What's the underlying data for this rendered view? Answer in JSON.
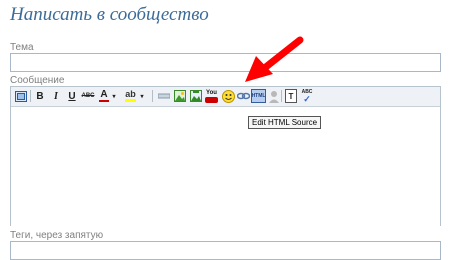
{
  "page": {
    "title": "Написать в сообщество"
  },
  "form": {
    "topic_label": "Тема",
    "topic_value": "",
    "message_label": "Сообщение",
    "message_value": "",
    "tags_label": "Теги, через запятую",
    "tags_value": ""
  },
  "toolbar": {
    "bold": "B",
    "italic": "I",
    "underline": "U",
    "strike": "ABC",
    "font_color": "A",
    "highlight": "ab",
    "youtube": "You",
    "html_source": "HTML",
    "plain_text": "T",
    "spellcheck": "ABC",
    "tooltip": "Edit HTML Source"
  },
  "colors": {
    "title": "#3d6b98",
    "arrow": "#ff0000",
    "font_color_bar": "#cc0000",
    "highlight_bar": "#ffff00"
  },
  "icons": {
    "annotation": "red-arrow-icon",
    "toolbar": [
      "fullscreen-icon",
      "bold-icon",
      "italic-icon",
      "underline-icon",
      "strikethrough-icon",
      "font-color-icon",
      "highlight-icon",
      "horizontal-rule-icon",
      "insert-image-icon",
      "insert-image-alt-icon",
      "youtube-icon",
      "smiley-icon",
      "link-icon",
      "html-source-icon",
      "user-icon",
      "plain-text-icon",
      "spellcheck-icon"
    ]
  }
}
